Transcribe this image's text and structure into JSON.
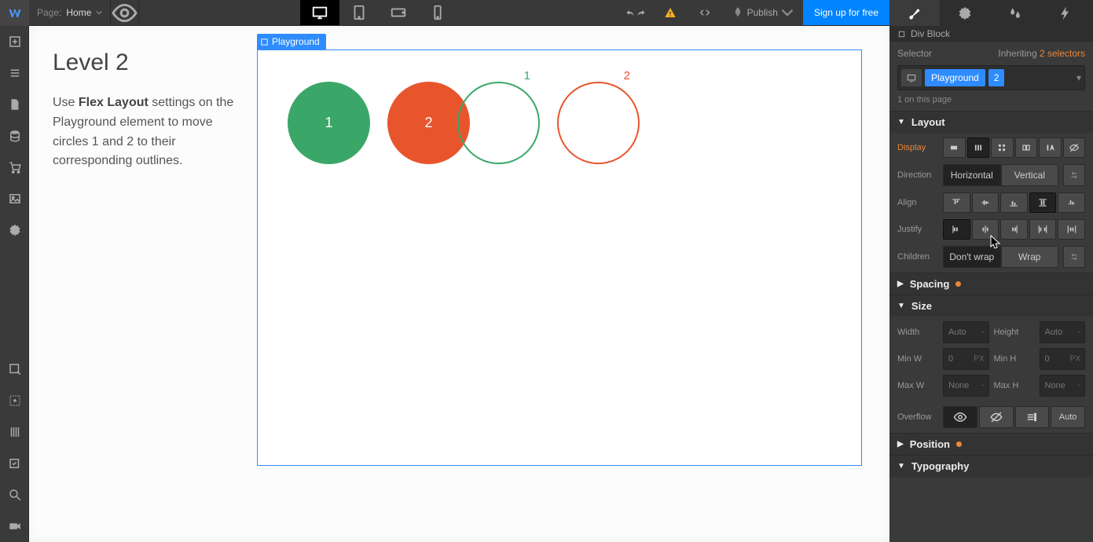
{
  "topbar": {
    "page_label": "Page:",
    "page_name": "Home",
    "publish_label": "Publish",
    "signup_label": "Sign up for free"
  },
  "header": {
    "element_type": "Div Block"
  },
  "selector": {
    "label": "Selector",
    "inheriting_label": "Inheriting",
    "inheriting_count": "2 selectors",
    "chips": [
      "Playground",
      "2"
    ],
    "count_line": "1 on this page"
  },
  "sections": {
    "layout": {
      "title": "Layout",
      "display_label": "Display",
      "direction_label": "Direction",
      "direction_options": [
        "Horizontal",
        "Vertical"
      ],
      "align_label": "Align",
      "justify_label": "Justify",
      "children_label": "Children",
      "children_options": [
        "Don't wrap",
        "Wrap"
      ]
    },
    "spacing": {
      "title": "Spacing"
    },
    "size": {
      "title": "Size",
      "width_label": "Width",
      "width_val": "Auto",
      "width_unit": "-",
      "height_label": "Height",
      "height_val": "Auto",
      "height_unit": "-",
      "minw_label": "Min W",
      "minw_val": "0",
      "minw_unit": "PX",
      "minh_label": "Min H",
      "minh_val": "0",
      "minh_unit": "PX",
      "maxw_label": "Max W",
      "maxw_val": "None",
      "maxw_unit": "-",
      "maxh_label": "Max H",
      "maxh_val": "None",
      "maxh_unit": "-",
      "overflow_label": "Overflow",
      "overflow_auto": "Auto"
    },
    "position": {
      "title": "Position"
    },
    "typography": {
      "title": "Typography"
    }
  },
  "canvas": {
    "tag": "Playground",
    "instr_title": "Level 2",
    "instr_pre": "Use ",
    "instr_bold": "Flex Layout",
    "instr_post": " settings on the Playground element to move circles 1 and 2 to their corresponding outlines.",
    "circles": {
      "one": "1",
      "two": "2"
    },
    "outlines": {
      "one": "1",
      "two": "2"
    }
  }
}
